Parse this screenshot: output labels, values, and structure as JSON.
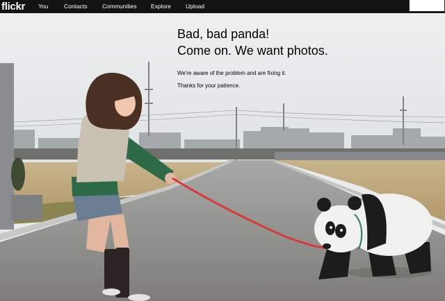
{
  "brand": {
    "logo_text": "flickr"
  },
  "nav": {
    "items": [
      {
        "label": "You"
      },
      {
        "label": "Contacts"
      },
      {
        "label": "Communities"
      },
      {
        "label": "Explore"
      },
      {
        "label": "Upload"
      }
    ],
    "search_placeholder": ""
  },
  "error": {
    "headline_line1": "Bad, bad panda!",
    "headline_line2": "Come on. We want photos.",
    "message_line1": "We're aware of the problem and are fixing it.",
    "message_line2": "Thanks for your patience."
  },
  "colors": {
    "topbar": "#131313",
    "leash": "#d63a3a",
    "sky": "#e9ecec"
  }
}
